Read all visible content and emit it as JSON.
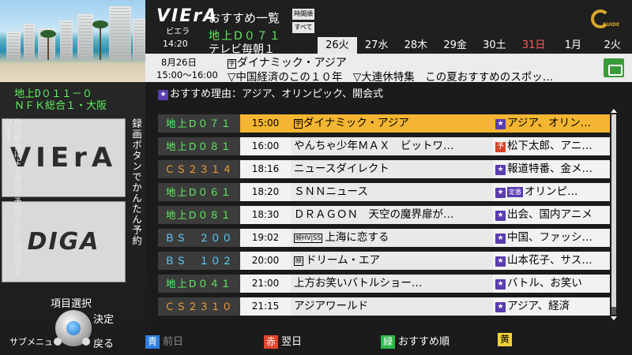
{
  "left_panel": {
    "channel_line1": "地上D０１１－０",
    "channel_line2": "ＮＦＫ総合１・大阪",
    "note_vertical": "局の都合により番組が予約されない場合があります",
    "viera_logo": "VIErA",
    "diga_logo": "DIGA",
    "record_hint_vertical": "録画ボタンでかんたん予約",
    "nav_select": "項目選択",
    "nav_decide": "決定",
    "nav_submenu": "サブメニュー",
    "nav_back": "戻る"
  },
  "header": {
    "brand": "VIErA",
    "brand_sub": "ビエラ",
    "clock": "14:20",
    "title": "おすすめ一覧",
    "sort_time": "時間順",
    "sort_all": "すべて",
    "current_channel": "地上D０７１",
    "current_program": "テレビ毎朝１",
    "gguide_text": "GUIDE",
    "dates": [
      "26火",
      "27水",
      "28木",
      "29金",
      "30土",
      "31日",
      "1月",
      "2火"
    ]
  },
  "info_bar": {
    "date": "8月26日",
    "time": "15:00～16:00",
    "title": "ダイナミック・アジア",
    "description": "▽中国経済のこの１０年　▽大連休特集　この夏おすすめのスポッ…"
  },
  "reason_line": "おすすめ理由：アジア、オリンピック、開会式",
  "rows": [
    {
      "channel": "地上D０７１",
      "time": "15:00",
      "title": "ダイナミック・アジア",
      "reason": "アジア、オリン…",
      "ch_type": "gr",
      "badge": "star",
      "title_mark": "sb",
      "selected": true
    },
    {
      "channel": "地上D０８１",
      "time": "16:00",
      "title": "やんちゃ少年ＭＡＸ　ビットワ…",
      "reason": "松下太郎、アニ…",
      "ch_type": "gr",
      "badge": "yo"
    },
    {
      "channel": "ＣＳ２３１４",
      "time": "18:16",
      "title": "ニュースダイレクト",
      "reason": "報道特番、金メ…",
      "ch_type": "cs",
      "badge": "star"
    },
    {
      "channel": "地上D０６１",
      "time": "18:20",
      "title": "ＳＮＮニュース",
      "reason": "オリンピ…",
      "ch_type": "gr",
      "badge": "star",
      "extra_badge": "定番"
    },
    {
      "channel": "地上D０８１",
      "time": "18:30",
      "title": "ＤＲＡＧＯＮ　天空の魔界扉が…",
      "reason": "出会、国内アニメ",
      "ch_type": "gr",
      "badge": "star"
    },
    {
      "channel": "ＢＳ　２００",
      "time": "19:02",
      "title": "上海に恋する",
      "reason": "中国、ファッシ…",
      "ch_type": "bs",
      "badge": "star",
      "title_mark": "hv"
    },
    {
      "channel": "ＢＳ　１０２",
      "time": "20:00",
      "title": "ドリーム・エア",
      "reason": "山本花子、サス…",
      "ch_type": "bs",
      "badge": "star",
      "title_mark": "ei"
    },
    {
      "channel": "地上D０４１",
      "time": "21:00",
      "title": "上方お笑いバトルショー…",
      "reason": "バトル、お笑い",
      "ch_type": "gr",
      "badge": "star"
    },
    {
      "channel": "ＣＳ２３１０",
      "time": "21:15",
      "title": "アジアワールド",
      "reason": "アジア、経済",
      "ch_type": "cs",
      "badge": "star"
    }
  ],
  "footer": {
    "blue_key": "青",
    "blue_label": "前日",
    "red_key": "赤",
    "red_label": "翌日",
    "green_key": "緑",
    "green_label": "おすすめ順",
    "yellow_key": "黄"
  },
  "colors": {
    "terrestrial": "#5ef05e",
    "cs": "#f2a233",
    "bs": "#5fd2ff",
    "selected_row": "#f4b632",
    "star_badge": "#5a3cb0"
  }
}
